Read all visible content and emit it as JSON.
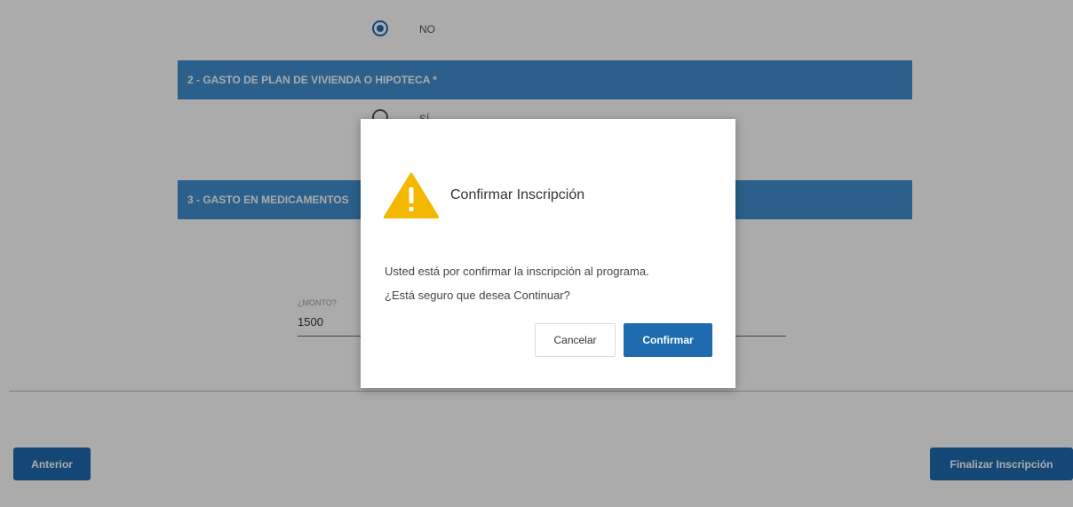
{
  "form": {
    "q1_no_label": "NO",
    "section2_title": "2 - GASTO DE PLAN DE VIVIENDA O HIPOTECA *",
    "section2_si_label": "SÍ",
    "section3_title": "3 - GASTO EN MEDICAMENTOS",
    "monto_label": "¿MONTO?",
    "monto_value": "1500"
  },
  "footer": {
    "prev_label": "Anterior",
    "finish_label": "Finalizar Inscripción"
  },
  "dialog": {
    "title": "Confirmar Inscripción",
    "line1": "Usted está por confirmar la inscripción al programa.",
    "line2": "¿Está seguro que desea Continuar?",
    "cancel_label": "Cancelar",
    "confirm_label": "Confirmar",
    "icon": "warning-icon"
  },
  "colors": {
    "primary": "#1f6bb0",
    "section_bar": "#3f8fd0",
    "warning": "#f5b800"
  }
}
